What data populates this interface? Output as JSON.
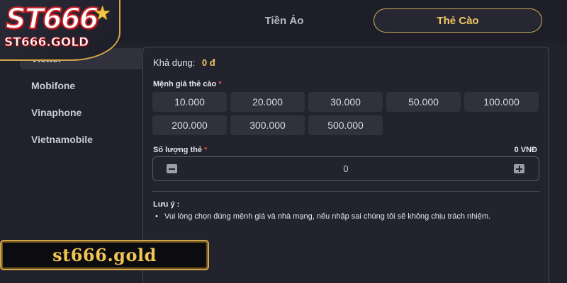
{
  "brand": {
    "logo_main": "ST666",
    "logo_sub": "ST666.GOLD",
    "watermark": "st666.gold"
  },
  "tabs": [
    {
      "label": "Tiền Ảo",
      "active": false
    },
    {
      "label": "Thẻ Cào",
      "active": true
    }
  ],
  "sidebar": {
    "items": [
      {
        "label": "Viettel",
        "active": true
      },
      {
        "label": "Mobifone",
        "active": false
      },
      {
        "label": "Vinaphone",
        "active": false
      },
      {
        "label": "Vietnamobile",
        "active": false
      }
    ]
  },
  "form": {
    "available_label": "Khả dụng:",
    "available_value": "0 đ",
    "denomination_label": "Mệnh giá thẻ cào",
    "required_mark": "*",
    "denominations": [
      "10.000",
      "20.000",
      "30.000",
      "50.000",
      "100.000",
      "200.000",
      "300.000",
      "500.000"
    ],
    "quantity_label": "Số lượng thẻ",
    "quantity_amount": "0 VNĐ",
    "quantity_value": "0",
    "note_title": "Lưu ý :",
    "note_bullet": "•",
    "note_text": "Vui lòng chọn đúng mệnh giá và nhà mạng, nếu nhập sai chúng tôi sẽ không chịu trách nhiệm."
  },
  "colors": {
    "accent": "#f3c965",
    "background": "#20212b",
    "chip": "#30313d",
    "required": "#e5484d"
  },
  "icons": {
    "minus": "minus-icon",
    "plus": "plus-icon",
    "star": "star-icon"
  }
}
